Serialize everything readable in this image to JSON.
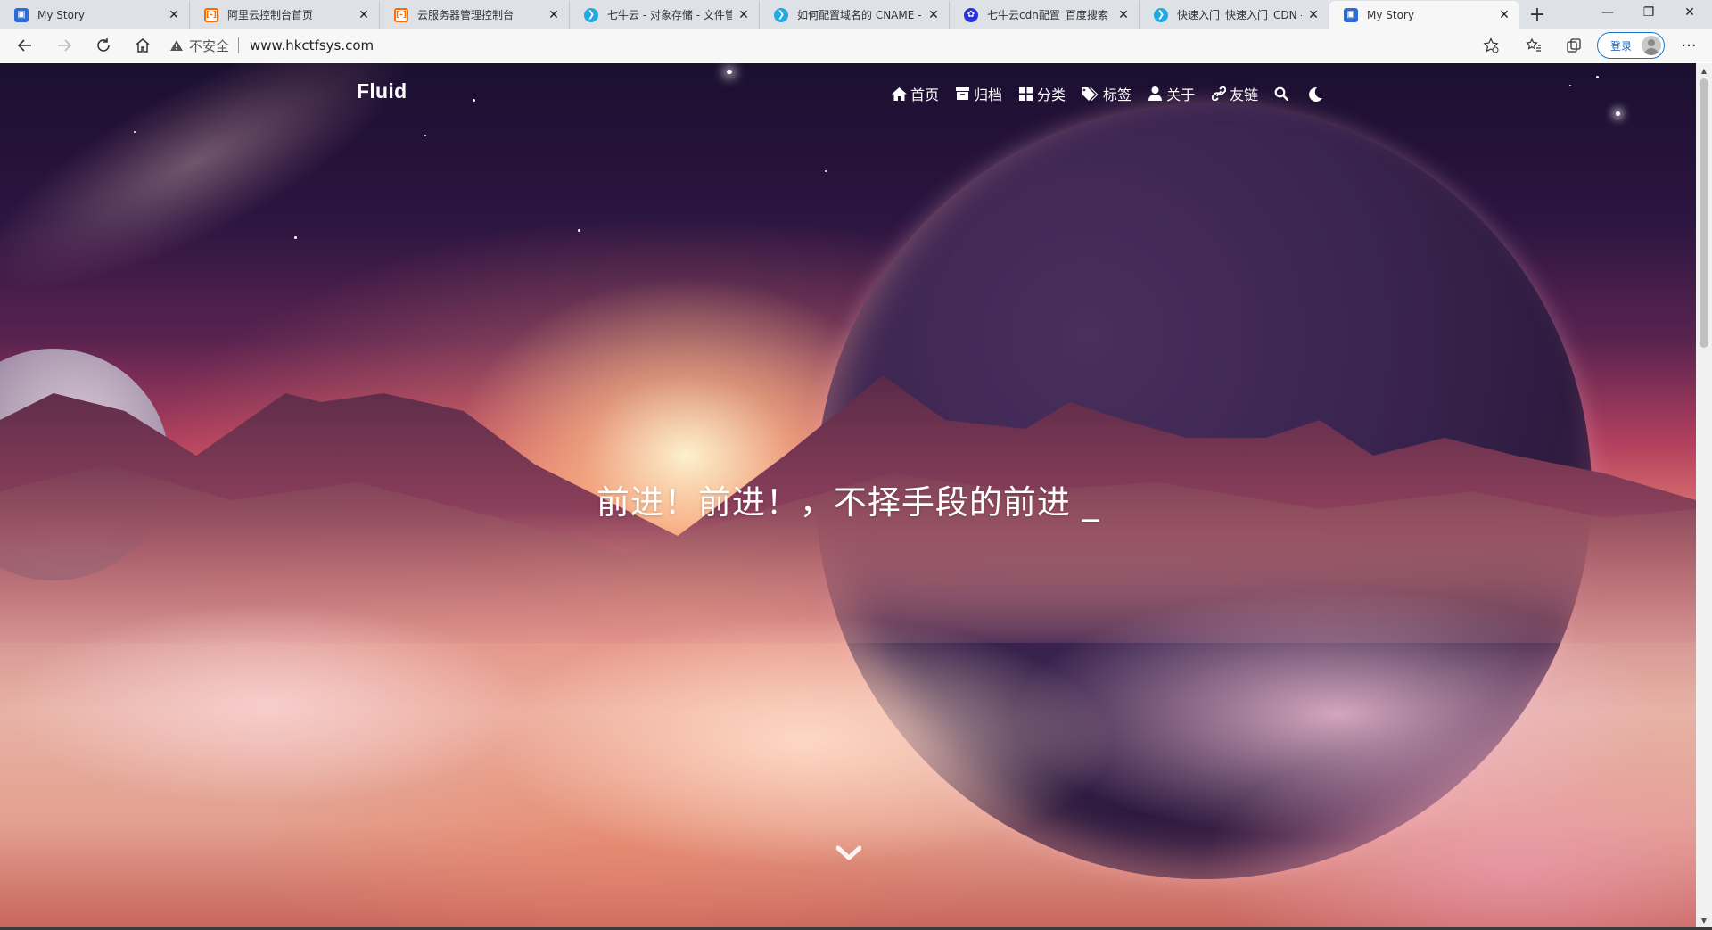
{
  "browser": {
    "tabs": [
      {
        "title": "My Story",
        "favicon": "story-icon"
      },
      {
        "title": "阿里云控制台首页",
        "favicon": "aliyun-icon"
      },
      {
        "title": "云服务器管理控制台",
        "favicon": "aliyun-icon"
      },
      {
        "title": "七牛云 - 对象存储 - 文件管",
        "favicon": "qiniu-icon"
      },
      {
        "title": "如何配置域名的 CNAME - 七",
        "favicon": "qiniu-icon"
      },
      {
        "title": "七牛云cdn配置_百度搜索",
        "favicon": "baidu-icon"
      },
      {
        "title": "快速入门_快速入门_CDN -",
        "favicon": "qiniu-icon"
      },
      {
        "title": "My Story",
        "favicon": "story-icon",
        "active": true
      }
    ],
    "new_tab": "+",
    "window": {
      "minimize": "—",
      "restore": "❐",
      "close": "✕"
    },
    "address": {
      "security_label": "不安全",
      "url": "www.hkctfsys.com"
    },
    "login_label": "登录"
  },
  "site": {
    "brand": "Fluid",
    "menu": [
      {
        "label": "首页",
        "icon": "home-icon"
      },
      {
        "label": "归档",
        "icon": "archive-icon"
      },
      {
        "label": "分类",
        "icon": "category-icon"
      },
      {
        "label": "标签",
        "icon": "tags-icon"
      },
      {
        "label": "关于",
        "icon": "user-icon"
      },
      {
        "label": "友链",
        "icon": "link-icon"
      }
    ],
    "slogan": "前进！前进！，不择手段的前进 _",
    "colors": {
      "text": "#ffffff",
      "accent": "#2c6bd8"
    }
  }
}
